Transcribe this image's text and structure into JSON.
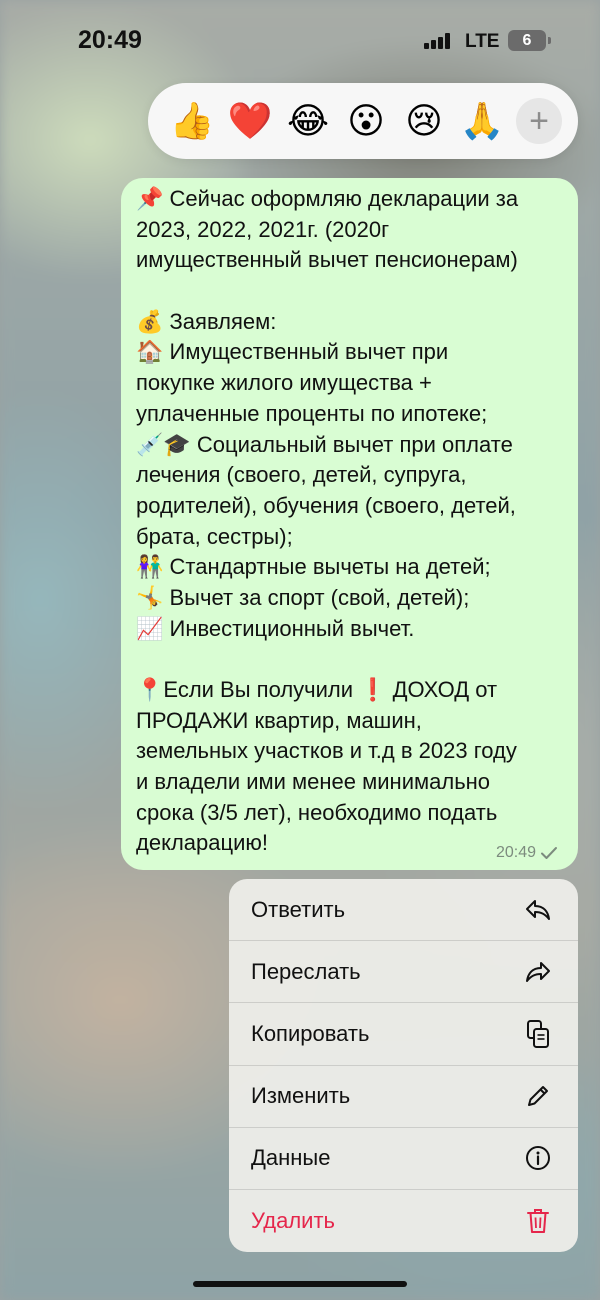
{
  "status": {
    "time": "20:49",
    "network": "LTE",
    "battery": "6"
  },
  "reactions": {
    "items": [
      {
        "emoji": "👍",
        "name": "thumbs-up"
      },
      {
        "emoji": "❤️",
        "name": "heart"
      },
      {
        "emoji": "😂",
        "name": "tears-of-joy"
      },
      {
        "emoji": "😮",
        "name": "surprised"
      },
      {
        "emoji": "😢",
        "name": "crying"
      },
      {
        "emoji": "🙏",
        "name": "folded-hands"
      }
    ],
    "more": "+"
  },
  "message": {
    "lines": [
      "📌 Сейчас оформляю декларации за",
      "2023, 2022, 2021г. (2020г",
      "имущественный вычет пенсионерам)",
      "",
      "💰 Заявляем:",
      "🏠 Имущественный вычет при",
      "покупке жилого имущества +",
      "уплаченные проценты по ипотеке;",
      "💉🎓 Социальный вычет при оплате",
      "лечения (своего, детей, супруга,",
      "родителей), обучения (своего, детей,",
      "брата, сестры);",
      "👫 Стандартные вычеты на детей;",
      "🤸 Вычет за спорт (свой, детей);",
      "📈 Инвестиционный вычет.",
      "",
      "📍Если Вы получили ❗ ДОХОД от",
      "ПРОДАЖИ квартир, машин,",
      "земельных участков и т.д в 2023 году",
      "и владели ими менее минимально",
      "срока (3/5 лет), необходимо подать",
      "декларацию!"
    ],
    "time": "20:49",
    "bubble_color": "#d9fdd3"
  },
  "menu": {
    "items": [
      {
        "label": "Ответить",
        "icon": "reply-icon"
      },
      {
        "label": "Переслать",
        "icon": "forward-icon"
      },
      {
        "label": "Копировать",
        "icon": "copy-icon"
      },
      {
        "label": "Изменить",
        "icon": "pencil-icon"
      },
      {
        "label": "Данные",
        "icon": "info-icon"
      },
      {
        "label": "Удалить",
        "icon": "trash-icon"
      }
    ],
    "danger_color": "#e5264b"
  }
}
